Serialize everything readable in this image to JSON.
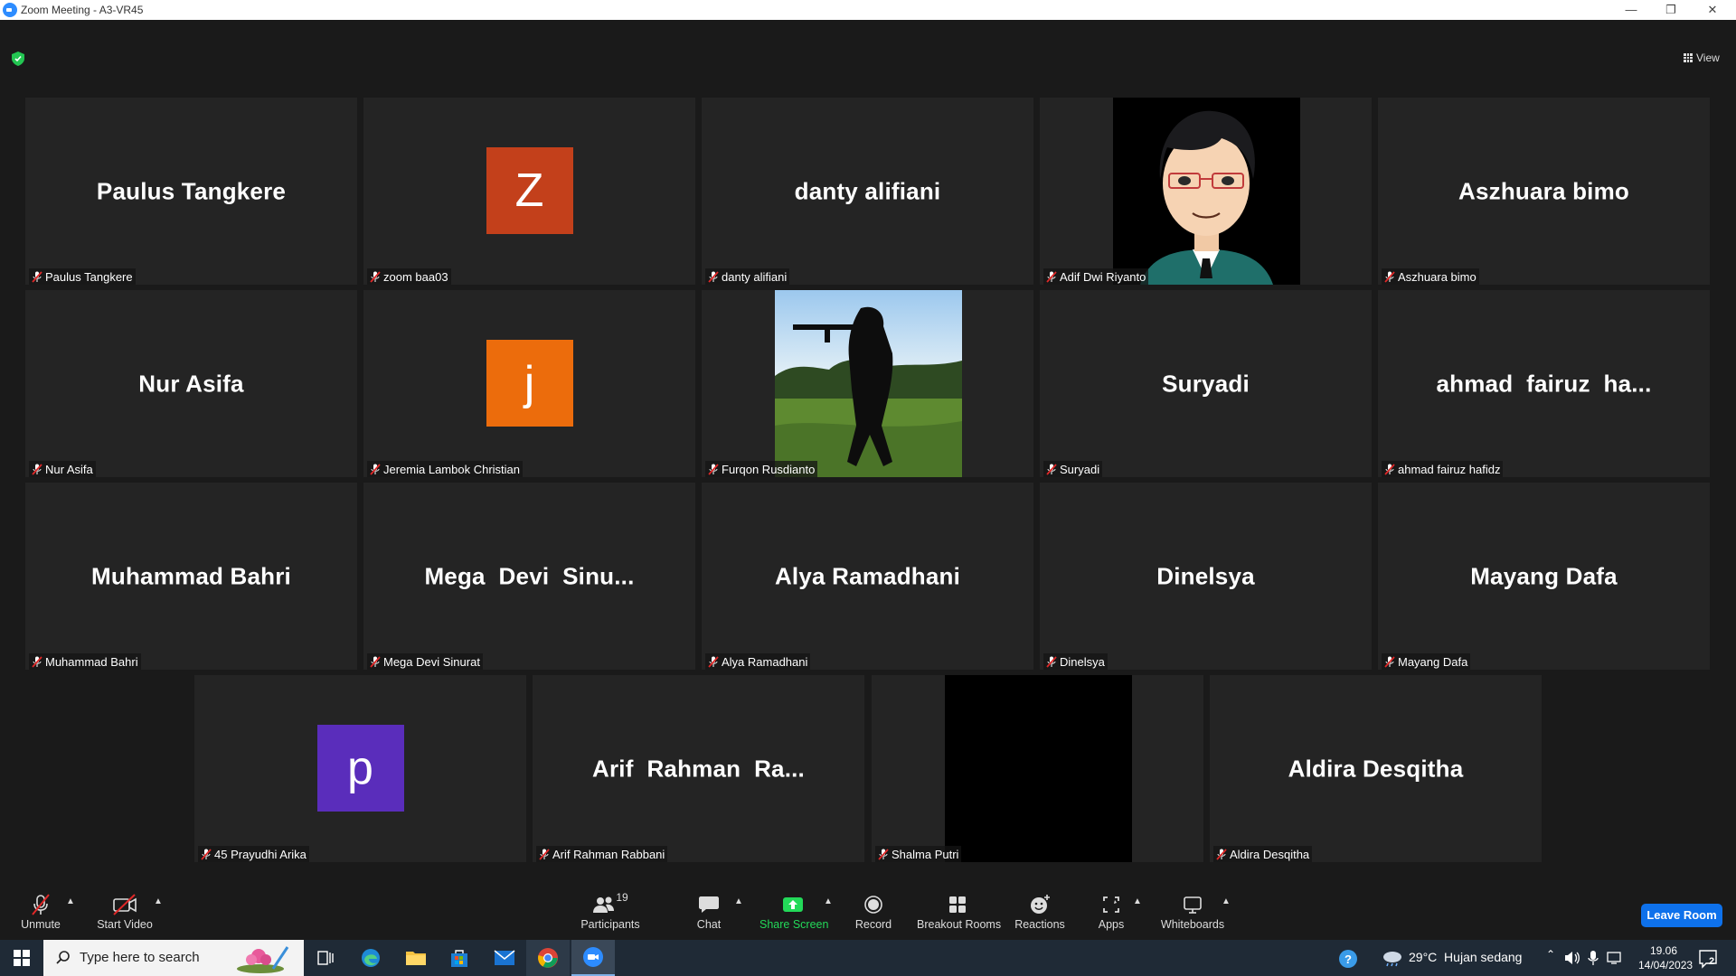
{
  "window": {
    "title": "Zoom Meeting - A3-VR45"
  },
  "header": {
    "view_label": "View"
  },
  "tiles": [
    {
      "big": "Paulus Tangkere",
      "label": "Paulus Tangkere"
    },
    {
      "avatar": "Z",
      "avatar_color": "#c3401b",
      "label": "zoom baa03"
    },
    {
      "big": "danty alifiani",
      "label": "danty alifiani"
    },
    {
      "image": "cartoon-man-avatar",
      "label": "Adif Dwi Riyanto"
    },
    {
      "big": "Aszhuara bimo",
      "label": "Aszhuara bimo"
    },
    {
      "big": "Nur Asifa",
      "label": "Nur Asifa"
    },
    {
      "avatar": "j",
      "avatar_color": "#ec6c0c",
      "label": "Jeremia Lambok Christian"
    },
    {
      "image": "soldier-silhouette-photo",
      "label": "Furqon Rusdianto"
    },
    {
      "big": "Suryadi",
      "label": "Suryadi"
    },
    {
      "big": "ahmad  fairuz  ha...",
      "label": "ahmad fairuz hafidz"
    },
    {
      "big": "Muhammad Bahri",
      "label": "Muhammad Bahri"
    },
    {
      "big": "Mega  Devi  Sinu...",
      "label": "Mega Devi Sinurat"
    },
    {
      "big": "Alya Ramadhani",
      "label": "Alya Ramadhani"
    },
    {
      "big": "Dinelsya",
      "label": "Dinelsya"
    },
    {
      "big": "Mayang Dafa",
      "label": "Mayang Dafa"
    },
    {
      "avatar": "p",
      "avatar_color": "#5a2dbb",
      "label": "45 Prayudhi Arika"
    },
    {
      "big": "Arif  Rahman  Ra...",
      "label": "Arif Rahman Rabbani"
    },
    {
      "image": "black-video",
      "label": "Shalma Putri"
    },
    {
      "big": "Aldira Desqitha",
      "label": "Aldira Desqitha"
    }
  ],
  "toolbar": {
    "unmute": "Unmute",
    "start_video": "Start Video",
    "participants": "Participants",
    "participants_count": "19",
    "chat": "Chat",
    "share_screen": "Share Screen",
    "record": "Record",
    "breakout_rooms": "Breakout Rooms",
    "reactions": "Reactions",
    "apps": "Apps",
    "whiteboards": "Whiteboards",
    "leave": "Leave Room"
  },
  "taskbar": {
    "search_placeholder": "Type here to search",
    "weather": "29°C  Hujan sedang",
    "time": "19.06",
    "date": "14/04/2023",
    "notif_count": "2"
  },
  "colors": {
    "share_green": "#23d959",
    "leave_blue": "#0e71eb",
    "mic_red": "#e02828"
  }
}
